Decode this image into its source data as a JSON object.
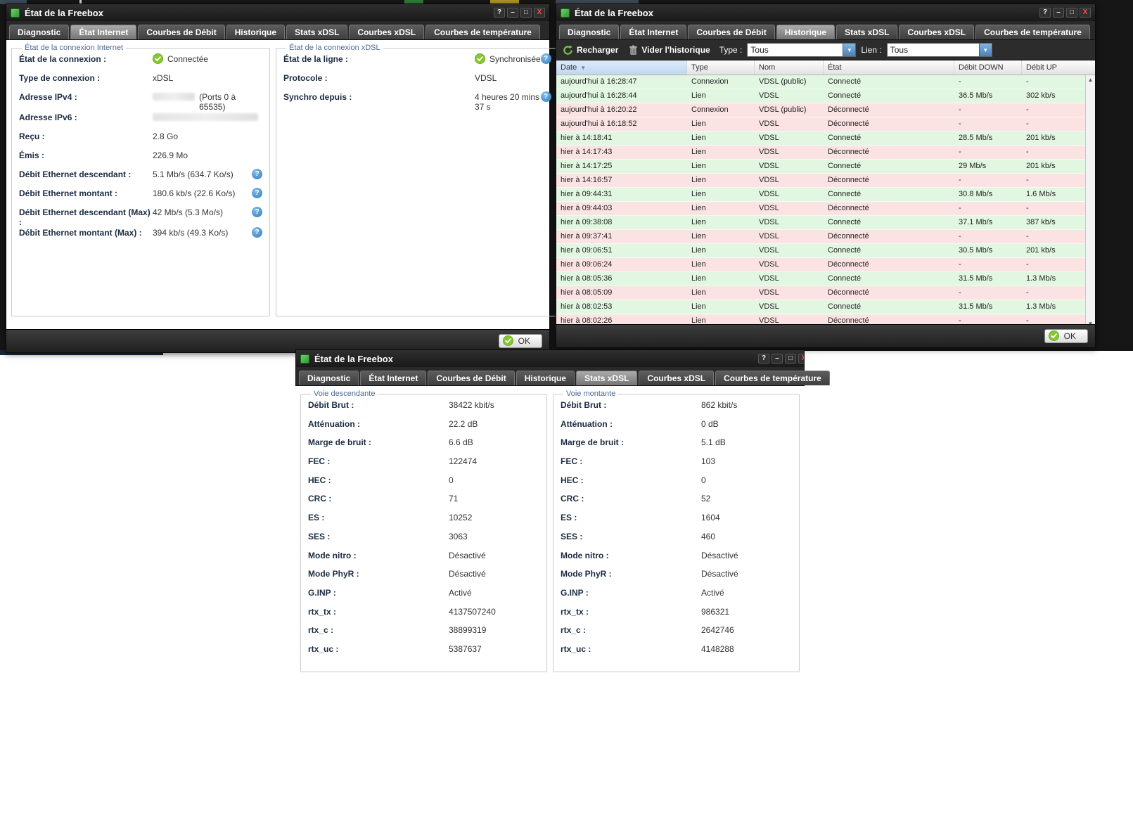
{
  "window_title": "État de la Freebox",
  "tabs": [
    "Diagnostic",
    "État Internet",
    "Courbes de Débit",
    "Historique",
    "Stats xDSL",
    "Courbes xDSL",
    "Courbes de température"
  ],
  "titlebar_buttons": {
    "help": "?",
    "minimize": "–",
    "maximize": "□",
    "close": "X"
  },
  "icons": {
    "sort_desc": "▼",
    "scroll_up": "▲",
    "scroll_down": "▼",
    "dropdown": "▾",
    "help_glyph": "?"
  },
  "colors": {
    "accent_green": "#7dc42f",
    "help_blue": "#3f92d2",
    "row_connected": "#e1f7e1",
    "row_disconnected": "#fce3e3",
    "close_red": "#ff4c4c",
    "legend_blue": "#4f6b8f"
  },
  "win1": {
    "active_tab": 1,
    "ok_label": "OK",
    "internet": {
      "legend": "État de la connexion Internet",
      "rows": [
        {
          "label": "État de la connexion :",
          "value": "Connectée",
          "status": "check"
        },
        {
          "label": "Type de connexion :",
          "value": "xDSL"
        },
        {
          "label": "Adresse IPv4 :",
          "value": "(Ports 0 à 65535)",
          "redacted": true
        },
        {
          "label": "Adresse IPv6 :",
          "value": "",
          "redacted": true
        },
        {
          "label": "Reçu :",
          "value": "2.8 Go"
        },
        {
          "label": "Émis :",
          "value": "226.9 Mo"
        },
        {
          "label": "Débit Ethernet descendant :",
          "value": "5.1 Mb/s (634.7 Ko/s)",
          "help": true
        },
        {
          "label": "Débit Ethernet montant :",
          "value": "180.6 kb/s (22.6 Ko/s)",
          "help": true
        },
        {
          "label": "Débit Ethernet descendant (Max) :",
          "value": "42 Mb/s (5.3 Mo/s)",
          "help": true
        },
        {
          "label": "Débit Ethernet montant (Max) :",
          "value": "394 kb/s (49.3 Ko/s)",
          "help": true
        }
      ]
    },
    "xdsl": {
      "legend": "État de la connexion xDSL",
      "rows": [
        {
          "label": "État de la ligne :",
          "value": "Synchronisée",
          "status": "check",
          "help": true
        },
        {
          "label": "Protocole :",
          "value": "VDSL"
        },
        {
          "label": "Synchro depuis :",
          "value": "4 heures 20 mins 37 s",
          "help": true
        }
      ]
    }
  },
  "win2": {
    "active_tab": 3,
    "ok_label": "OK",
    "toolbar": {
      "recharger": "Recharger",
      "vider": "Vider l'historique",
      "type_label": "Type :",
      "type_value": "Tous",
      "lien_label": "Lien :",
      "lien_value": "Tous"
    },
    "table": {
      "columns": [
        "Date",
        "Type",
        "Nom",
        "État",
        "Débit DOWN",
        "Débit UP"
      ],
      "rows": [
        [
          "aujourd'hui à 16:28:47",
          "Connexion",
          "VDSL (public)",
          "Connecté",
          "-",
          "-"
        ],
        [
          "aujourd'hui à 16:28:44",
          "Lien",
          "VDSL",
          "Connecté",
          "36.5 Mb/s",
          "302 kb/s"
        ],
        [
          "aujourd'hui à 16:20:22",
          "Connexion",
          "VDSL (public)",
          "Déconnecté",
          "-",
          "-"
        ],
        [
          "aujourd'hui à 16:18:52",
          "Lien",
          "VDSL",
          "Déconnecté",
          "-",
          "-"
        ],
        [
          "hier à 14:18:41",
          "Lien",
          "VDSL",
          "Connecté",
          "28.5 Mb/s",
          "201 kb/s"
        ],
        [
          "hier à 14:17:43",
          "Lien",
          "VDSL",
          "Déconnecté",
          "-",
          "-"
        ],
        [
          "hier à 14:17:25",
          "Lien",
          "VDSL",
          "Connecté",
          "29 Mb/s",
          "201 kb/s"
        ],
        [
          "hier à 14:16:57",
          "Lien",
          "VDSL",
          "Déconnecté",
          "-",
          "-"
        ],
        [
          "hier à 09:44:31",
          "Lien",
          "VDSL",
          "Connecté",
          "30.8 Mb/s",
          "1.6 Mb/s"
        ],
        [
          "hier à 09:44:03",
          "Lien",
          "VDSL",
          "Déconnecté",
          "-",
          "-"
        ],
        [
          "hier à 09:38:08",
          "Lien",
          "VDSL",
          "Connecté",
          "37.1 Mb/s",
          "387 kb/s"
        ],
        [
          "hier à 09:37:41",
          "Lien",
          "VDSL",
          "Déconnecté",
          "-",
          "-"
        ],
        [
          "hier à 09:06:51",
          "Lien",
          "VDSL",
          "Connecté",
          "30.5 Mb/s",
          "201 kb/s"
        ],
        [
          "hier à 09:06:24",
          "Lien",
          "VDSL",
          "Déconnecté",
          "-",
          "-"
        ],
        [
          "hier à 08:05:36",
          "Lien",
          "VDSL",
          "Connecté",
          "31.5 Mb/s",
          "1.3 Mb/s"
        ],
        [
          "hier à 08:05:09",
          "Lien",
          "VDSL",
          "Déconnecté",
          "-",
          "-"
        ],
        [
          "hier à 08:02:53",
          "Lien",
          "VDSL",
          "Connecté",
          "31.5 Mb/s",
          "1.3 Mb/s"
        ],
        [
          "hier à 08:02:26",
          "Lien",
          "VDSL",
          "Déconnecté",
          "-",
          "-"
        ]
      ]
    }
  },
  "win3": {
    "active_tab": 4,
    "down": {
      "legend": "Voie descendante",
      "rows": [
        {
          "label": "Débit Brut :",
          "value": "38422 kbit/s"
        },
        {
          "label": "Atténuation :",
          "value": "22.2 dB"
        },
        {
          "label": "Marge de bruit :",
          "value": "6.6 dB"
        },
        {
          "label": "FEC :",
          "value": "122474"
        },
        {
          "label": "HEC :",
          "value": "0"
        },
        {
          "label": "CRC :",
          "value": "71"
        },
        {
          "label": "ES :",
          "value": "10252"
        },
        {
          "label": "SES :",
          "value": "3063"
        },
        {
          "label": "Mode nitro :",
          "value": "Désactivé"
        },
        {
          "label": "Mode PhyR :",
          "value": "Désactivé"
        },
        {
          "label": "G.INP :",
          "value": "Activé"
        },
        {
          "label": "rtx_tx :",
          "value": "4137507240"
        },
        {
          "label": "rtx_c :",
          "value": "38899319"
        },
        {
          "label": "rtx_uc :",
          "value": "5387637"
        }
      ]
    },
    "up": {
      "legend": "Voie montante",
      "rows": [
        {
          "label": "Débit Brut :",
          "value": "862 kbit/s"
        },
        {
          "label": "Atténuation :",
          "value": "0 dB"
        },
        {
          "label": "Marge de bruit :",
          "value": "5.1 dB"
        },
        {
          "label": "FEC :",
          "value": "103"
        },
        {
          "label": "HEC :",
          "value": "0"
        },
        {
          "label": "CRC :",
          "value": "52"
        },
        {
          "label": "ES :",
          "value": "1604"
        },
        {
          "label": "SES :",
          "value": "460"
        },
        {
          "label": "Mode nitro :",
          "value": "Désactivé"
        },
        {
          "label": "Mode PhyR :",
          "value": "Désactivé"
        },
        {
          "label": "G.INP :",
          "value": "Activé"
        },
        {
          "label": "rtx_tx :",
          "value": "986321"
        },
        {
          "label": "rtx_c :",
          "value": "2642746"
        },
        {
          "label": "rtx_uc :",
          "value": "4148288"
        }
      ]
    }
  }
}
